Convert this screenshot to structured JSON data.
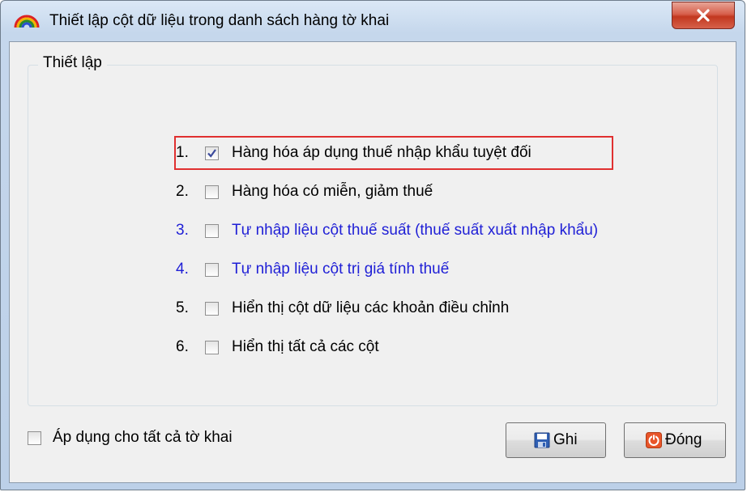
{
  "window": {
    "title": "Thiết lập cột dữ liệu trong danh sách hàng tờ khai"
  },
  "group": {
    "legend": "Thiết lập"
  },
  "options": [
    {
      "num": "1.",
      "label": "Hàng hóa áp dụng thuế nhập khẩu tuyệt đối",
      "checked": true,
      "color": "#000000"
    },
    {
      "num": "2.",
      "label": "Hàng hóa có miễn, giảm thuế",
      "checked": false,
      "color": "#000000"
    },
    {
      "num": "3.",
      "label": "Tự nhập liệu cột thuế suất (thuế suất xuất nhập khẩu)",
      "checked": false,
      "color": "#1f1fd6"
    },
    {
      "num": "4.",
      "label": "Tự nhập liệu cột trị giá tính thuế",
      "checked": false,
      "color": "#1f1fd6"
    },
    {
      "num": "5.",
      "label": "Hiển thị cột dữ liệu các khoản điều chỉnh",
      "checked": false,
      "color": "#000000"
    },
    {
      "num": "6.",
      "label": "Hiển thị tất cả các cột",
      "checked": false,
      "color": "#000000"
    }
  ],
  "footer": {
    "apply_all_label": "Áp dụng cho tất cả tờ khai",
    "apply_all_checked": false,
    "save_label": "Ghi",
    "close_label": "Đóng"
  },
  "icons": {
    "app": "rainbow-arc-icon",
    "close": "close-x-icon",
    "save": "floppy-disk-icon",
    "close_button": "power-icon"
  },
  "colors": {
    "highlight": "#e03030",
    "link_blue": "#1f1fd6"
  }
}
